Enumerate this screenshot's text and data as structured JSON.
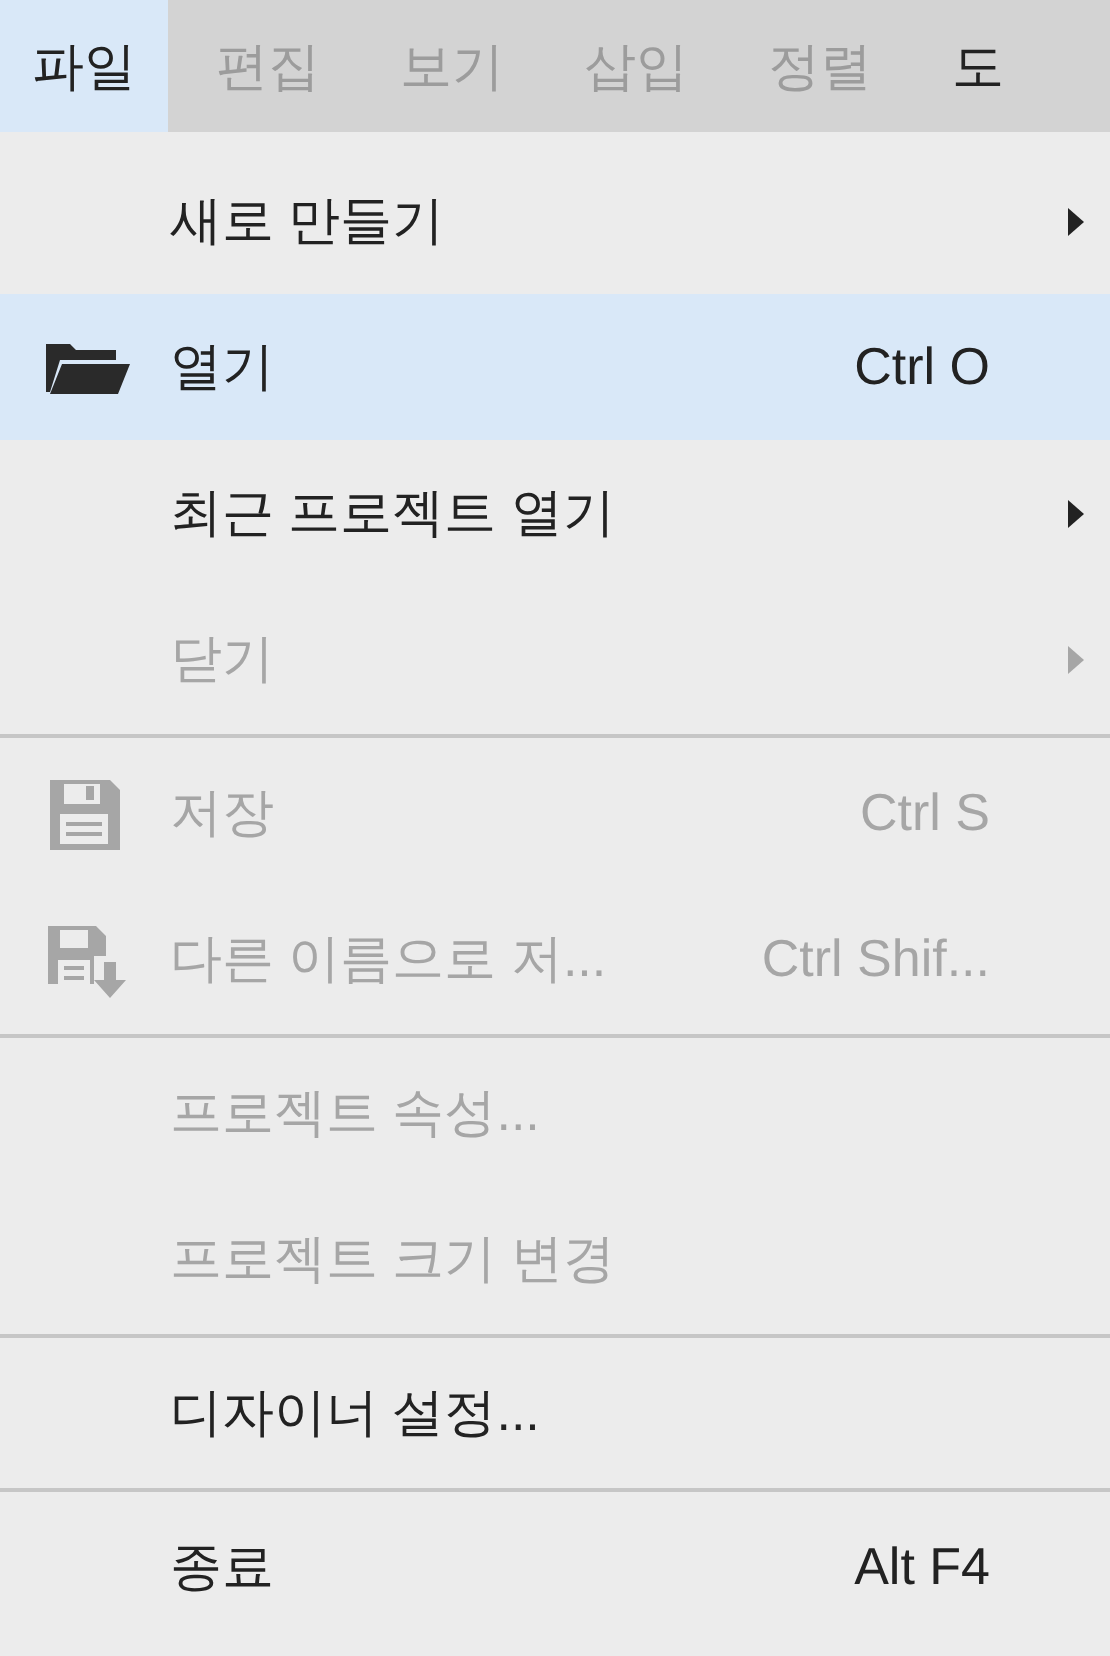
{
  "menu_bar": [
    {
      "label": "파일",
      "selected": true,
      "disabled": false
    },
    {
      "label": "편집",
      "selected": false,
      "disabled": true
    },
    {
      "label": "보기",
      "selected": false,
      "disabled": true
    },
    {
      "label": "삽입",
      "selected": false,
      "disabled": true
    },
    {
      "label": "정렬",
      "selected": false,
      "disabled": true
    },
    {
      "label": "도",
      "selected": false,
      "disabled": false
    }
  ],
  "menu": [
    {
      "kind": "item",
      "label": "새로 만들기",
      "submenu": true,
      "disabled": false,
      "selected": false
    },
    {
      "kind": "folder",
      "label": "열기",
      "shortcut": "Ctrl O",
      "disabled": false,
      "selected": true
    },
    {
      "kind": "item",
      "label": "최근 프로젝트 열기",
      "submenu": true,
      "disabled": false,
      "selected": false
    },
    {
      "kind": "item",
      "label": "닫기",
      "submenu": true,
      "disabled": true,
      "selected": false
    },
    {
      "kind": "separator"
    },
    {
      "kind": "save",
      "label": "저장",
      "shortcut": "Ctrl S",
      "disabled": true,
      "selected": false
    },
    {
      "kind": "save-as",
      "label": "다른 이름으로 저...",
      "shortcut": "Ctrl Shif...",
      "disabled": true,
      "selected": false
    },
    {
      "kind": "separator"
    },
    {
      "kind": "item",
      "label": "프로젝트 속성...",
      "disabled": true,
      "selected": false
    },
    {
      "kind": "item",
      "label": "프로젝트 크기 변경",
      "disabled": true,
      "selected": false
    },
    {
      "kind": "separator"
    },
    {
      "kind": "item",
      "label": "디자이너 설정...",
      "disabled": false,
      "selected": false
    },
    {
      "kind": "separator"
    },
    {
      "kind": "item",
      "label": "종료",
      "shortcut": "Alt F4",
      "disabled": false,
      "selected": false
    }
  ]
}
